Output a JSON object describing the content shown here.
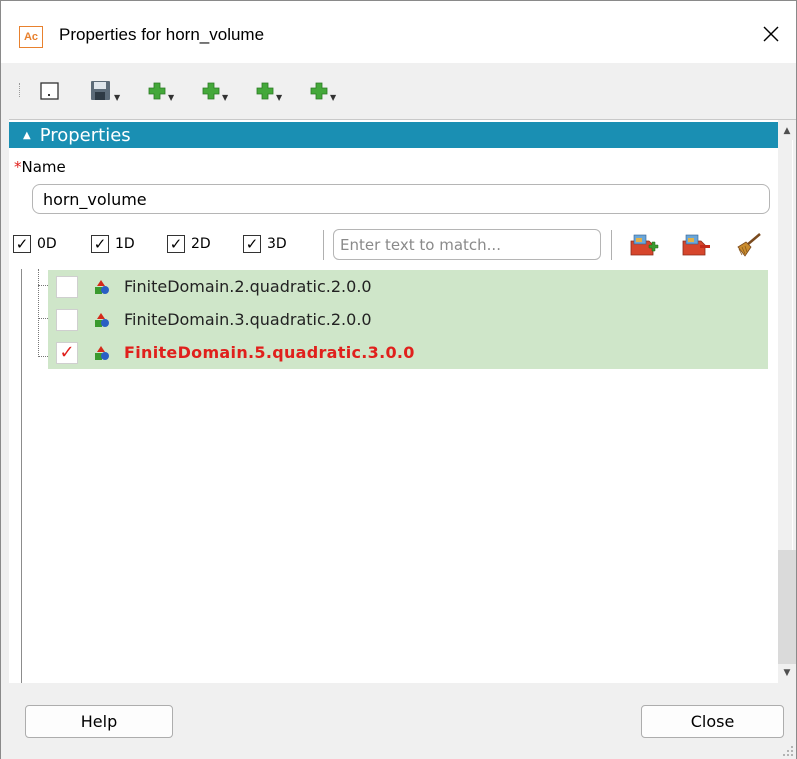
{
  "window": {
    "app_icon_text": "Ac",
    "title": "Properties for horn_volume"
  },
  "section": {
    "title": "Properties"
  },
  "name_field": {
    "required_mark": "*",
    "label": "Name",
    "value": "horn_volume"
  },
  "filter": {
    "dimensions": [
      {
        "label": "0D",
        "checked": true
      },
      {
        "label": "1D",
        "checked": true
      },
      {
        "label": "2D",
        "checked": true
      },
      {
        "label": "3D",
        "checked": true
      }
    ],
    "check_mark": "✓",
    "search_placeholder": "Enter text to match..."
  },
  "domains": [
    {
      "label": "FiniteDomain.2.quadratic.2.0.0",
      "checked": false
    },
    {
      "label": "FiniteDomain.3.quadratic.2.0.0",
      "checked": false
    },
    {
      "label": "FiniteDomain.5.quadratic.3.0.0",
      "checked": true
    }
  ],
  "footer": {
    "help_label": "Help",
    "close_label": "Close"
  },
  "colors": {
    "section_header": "#1a8fb3",
    "row_highlight": "#cfe6c9",
    "active_text": "#e0201c",
    "required": "#e0201c"
  }
}
